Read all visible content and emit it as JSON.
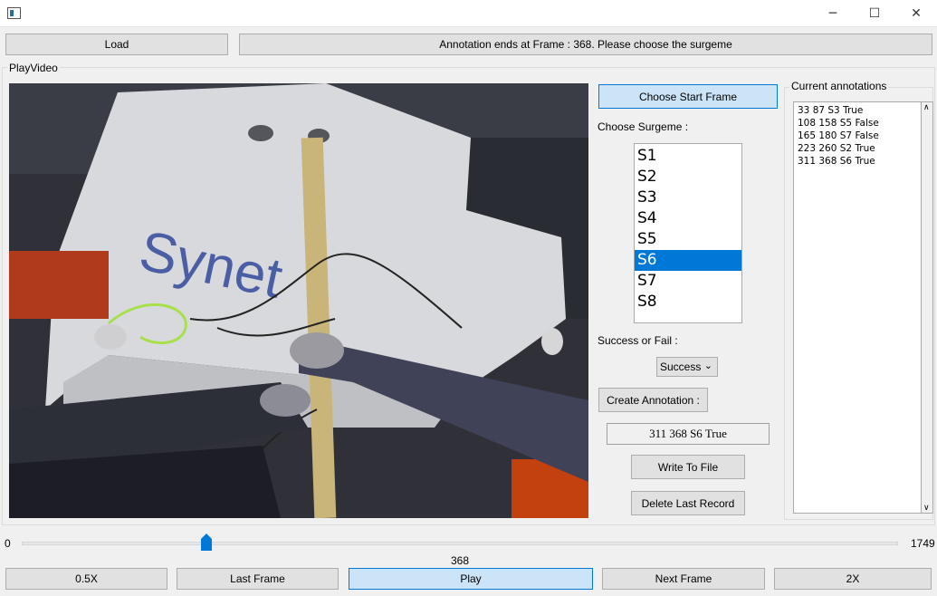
{
  "toolbar": {
    "load_label": "Load",
    "status_text": "Annotation ends at Frame : 368. Please choose the surgeme"
  },
  "playvideo": {
    "group_label": "PlayVideo"
  },
  "controls": {
    "choose_start_label": "Choose Start Frame",
    "choose_surgeme_label": "Choose Surgeme :",
    "surgemes": [
      "S1",
      "S2",
      "S3",
      "S4",
      "S5",
      "S6",
      "S7",
      "S8"
    ],
    "selected_surgeme": "S6",
    "success_fail_label": "Success or Fail :",
    "success_value": "Success",
    "create_annotation_label": "Create Annotation :",
    "annotation_field_value": "311 368 S6 True",
    "write_to_file_label": "Write To File",
    "delete_last_label": "Delete Last Record"
  },
  "annotations": {
    "group_label": "Current annotations",
    "items": [
      "33 87 S3 True",
      "108 158 S5 False",
      "165 180 S7 False",
      "223 260 S2 True",
      "311 368 S6 True"
    ]
  },
  "slider": {
    "min_label": "0",
    "max_label": "1749",
    "current_label": "368",
    "min": 0,
    "max": 1749,
    "value": 368
  },
  "playback": {
    "slow_label": "0.5X",
    "last_frame_label": "Last Frame",
    "play_label": "Play",
    "next_frame_label": "Next Frame",
    "fast_label": "2X"
  },
  "colors": {
    "selection": "#0078d7",
    "accent_button": "#cce4f7",
    "slider_handle": "#0078d7"
  }
}
